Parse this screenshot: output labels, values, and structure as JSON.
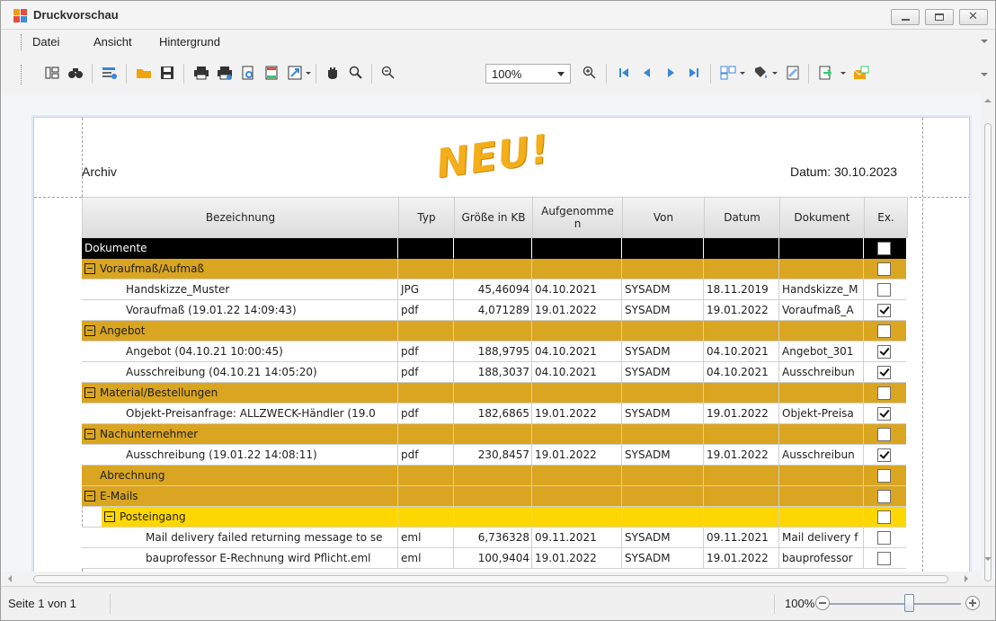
{
  "window": {
    "title": "Druckvorschau",
    "accent": "#f4ae1a"
  },
  "menu": {
    "items": [
      {
        "label": "Datei"
      },
      {
        "label": "Ansicht"
      },
      {
        "label": "Hintergrund"
      }
    ]
  },
  "toolbar": {
    "zoom_value": "100%",
    "icons": [
      "thumbnails-icon",
      "find-icon",
      "customize-icon",
      "open-icon",
      "save-icon",
      "print-icon",
      "quick-print-icon",
      "page-setup-icon",
      "header-footer-icon",
      "scale-icon",
      "hand-tool-icon",
      "magnifier-icon",
      "zoom-out-icon",
      "zoom-in-icon",
      "first-page-icon",
      "previous-page-icon",
      "next-page-icon",
      "last-page-icon",
      "multiple-pages-icon",
      "page-color-icon",
      "watermark-icon",
      "export-icon",
      "send-email-icon"
    ]
  },
  "page": {
    "header_left": "Archiv",
    "header_right": "Datum: 30.10.2023",
    "stamp": "NEU!",
    "columns": [
      "Bezeichnung",
      "Typ",
      "Größe in KB",
      "Aufgenomme n",
      "Von",
      "Datum",
      "Dokument",
      "Ex."
    ],
    "rows": [
      {
        "level": 0,
        "style": "black",
        "label": "Dokumente",
        "expander": false,
        "typ": "",
        "groesse": "",
        "aufgenommen": "",
        "von": "",
        "datum": "",
        "dokument": "",
        "checked": false
      },
      {
        "level": 1,
        "style": "group",
        "label": "Voraufmaß/Aufmaß",
        "expander": true,
        "typ": "",
        "groesse": "",
        "aufgenommen": "",
        "von": "",
        "datum": "",
        "dokument": "",
        "checked": false
      },
      {
        "level": 2,
        "style": "item",
        "label": "Handskizze_Muster",
        "expander": false,
        "typ": "JPG",
        "groesse": "45,46094",
        "aufgenommen": "04.10.2021",
        "von": "SYSADM",
        "datum": "18.11.2019",
        "dokument": "Handskizze_M",
        "checked": false
      },
      {
        "level": 2,
        "style": "item",
        "label": "Voraufmaß (19.01.22 14:09:43)",
        "expander": false,
        "typ": "pdf",
        "groesse": "4,071289",
        "aufgenommen": "19.01.2022",
        "von": "SYSADM",
        "datum": "19.01.2022",
        "dokument": "Voraufmaß_A",
        "checked": true
      },
      {
        "level": 1,
        "style": "group",
        "label": "Angebot",
        "expander": true,
        "typ": "",
        "groesse": "",
        "aufgenommen": "",
        "von": "",
        "datum": "",
        "dokument": "",
        "checked": false
      },
      {
        "level": 2,
        "style": "item",
        "label": "Angebot (04.10.21 10:00:45)",
        "expander": false,
        "typ": "pdf",
        "groesse": "188,9795",
        "aufgenommen": "04.10.2021",
        "von": "SYSADM",
        "datum": "04.10.2021",
        "dokument": "Angebot_301",
        "checked": true
      },
      {
        "level": 2,
        "style": "item",
        "label": "Ausschreibung (04.10.21 14:05:20)",
        "expander": false,
        "typ": "pdf",
        "groesse": "188,3037",
        "aufgenommen": "04.10.2021",
        "von": "SYSADM",
        "datum": "04.10.2021",
        "dokument": "Ausschreibun",
        "checked": true
      },
      {
        "level": 1,
        "style": "group",
        "label": "Material/Bestellungen",
        "expander": true,
        "typ": "",
        "groesse": "",
        "aufgenommen": "",
        "von": "",
        "datum": "",
        "dokument": "",
        "checked": false
      },
      {
        "level": 2,
        "style": "item",
        "label": "Objekt-Preisanfrage: ALLZWECK-Händler (19.0",
        "expander": false,
        "typ": "pdf",
        "groesse": "182,6865",
        "aufgenommen": "19.01.2022",
        "von": "SYSADM",
        "datum": "19.01.2022",
        "dokument": "Objekt-Preisa",
        "checked": true
      },
      {
        "level": 1,
        "style": "group",
        "label": "Nachunternehmer",
        "expander": true,
        "typ": "",
        "groesse": "",
        "aufgenommen": "",
        "von": "",
        "datum": "",
        "dokument": "",
        "checked": false
      },
      {
        "level": 2,
        "style": "item",
        "label": "Ausschreibung (19.01.22 14:08:11)",
        "expander": false,
        "typ": "pdf",
        "groesse": "230,8457",
        "aufgenommen": "19.01.2022",
        "von": "SYSADM",
        "datum": "19.01.2022",
        "dokument": "Ausschreibun",
        "checked": true
      },
      {
        "level": 1,
        "style": "group",
        "label": "Abrechnung",
        "expander": false,
        "typ": "",
        "groesse": "",
        "aufgenommen": "",
        "von": "",
        "datum": "",
        "dokument": "",
        "checked": false
      },
      {
        "level": 1,
        "style": "group",
        "label": "E-Mails",
        "expander": true,
        "typ": "",
        "groesse": "",
        "aufgenommen": "",
        "von": "",
        "datum": "",
        "dokument": "",
        "checked": false
      },
      {
        "level": 2,
        "style": "subgroup",
        "label": "Posteingang",
        "expander": true,
        "typ": "",
        "groesse": "",
        "aufgenommen": "",
        "von": "",
        "datum": "",
        "dokument": "",
        "checked": false
      },
      {
        "level": 3,
        "style": "item",
        "label": "Mail delivery failed returning message to se",
        "expander": false,
        "typ": "eml",
        "groesse": "6,736328",
        "aufgenommen": "09.11.2021",
        "von": "SYSADM",
        "datum": "09.11.2021",
        "dokument": "Mail delivery f",
        "checked": false
      },
      {
        "level": 3,
        "style": "item",
        "label": "bauprofessor E-Rechnung wird Pflicht.eml",
        "expander": false,
        "typ": "eml",
        "groesse": "100,9404",
        "aufgenommen": "19.01.2022",
        "von": "SYSADM",
        "datum": "19.01.2022",
        "dokument": "bauprofessor",
        "checked": false
      }
    ],
    "colors": {
      "black": "#000000",
      "group": "#daa520",
      "subgroup": "#ffd700",
      "item": "#ffffff"
    }
  },
  "status": {
    "page_info": "Seite 1 von 1",
    "zoom": "100%",
    "zoom_level_percent": 100
  }
}
